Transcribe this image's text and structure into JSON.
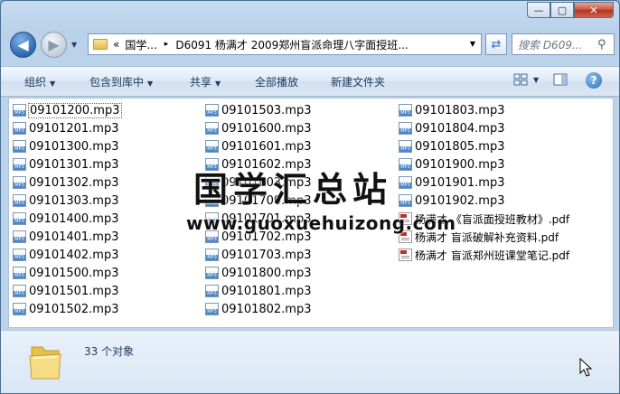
{
  "window": {
    "minimize": "—",
    "maximize": "▢",
    "close": "✕"
  },
  "address": {
    "history_glyph": "▼",
    "overflow": "«",
    "segments": [
      "国学...",
      "D6091 杨满才 2009郑州盲派命理八字面授班..."
    ],
    "separator": "▸",
    "dropdown": "▼"
  },
  "search": {
    "placeholder": "搜索 D609...",
    "icon": "magnifier-icon"
  },
  "toolbar": {
    "organize": "组织",
    "include_in_library": "包含到库中",
    "share": "共享",
    "play_all": "全部播放",
    "new_folder": "新建文件夹",
    "dropdown_arrow": "▼",
    "help": "?"
  },
  "files": {
    "col1": [
      {
        "name": "09101200.mp3",
        "type": "mp3",
        "selected": true
      },
      {
        "name": "09101201.mp3",
        "type": "mp3"
      },
      {
        "name": "09101300.mp3",
        "type": "mp3"
      },
      {
        "name": "09101301.mp3",
        "type": "mp3"
      },
      {
        "name": "09101302.mp3",
        "type": "mp3"
      },
      {
        "name": "09101303.mp3",
        "type": "mp3"
      },
      {
        "name": "09101400.mp3",
        "type": "mp3"
      },
      {
        "name": "09101401.mp3",
        "type": "mp3"
      },
      {
        "name": "09101402.mp3",
        "type": "mp3"
      },
      {
        "name": "09101500.mp3",
        "type": "mp3"
      },
      {
        "name": "09101501.mp3",
        "type": "mp3"
      },
      {
        "name": "09101502.mp3",
        "type": "mp3"
      }
    ],
    "col2": [
      {
        "name": "09101503.mp3",
        "type": "mp3"
      },
      {
        "name": "09101600.mp3",
        "type": "mp3"
      },
      {
        "name": "09101601.mp3",
        "type": "mp3"
      },
      {
        "name": "09101602.mp3",
        "type": "mp3"
      },
      {
        "name": "09101603.mp3",
        "type": "mp3"
      },
      {
        "name": "09101700.mp3",
        "type": "mp3"
      },
      {
        "name": "09101701.mp3",
        "type": "mp3"
      },
      {
        "name": "09101702.mp3",
        "type": "mp3"
      },
      {
        "name": "09101703.mp3",
        "type": "mp3"
      },
      {
        "name": "09101800.mp3",
        "type": "mp3"
      },
      {
        "name": "09101801.mp3",
        "type": "mp3"
      },
      {
        "name": "09101802.mp3",
        "type": "mp3"
      }
    ],
    "col3": [
      {
        "name": "09101803.mp3",
        "type": "mp3"
      },
      {
        "name": "09101804.mp3",
        "type": "mp3"
      },
      {
        "name": "09101805.mp3",
        "type": "mp3"
      },
      {
        "name": "09101900.mp3",
        "type": "mp3"
      },
      {
        "name": "09101901.mp3",
        "type": "mp3"
      },
      {
        "name": "09101902.mp3",
        "type": "mp3"
      },
      {
        "name": "杨满才 《盲派面授班教材》.pdf",
        "type": "pdf"
      },
      {
        "name": "杨满才 盲派破解补充资料.pdf",
        "type": "pdf"
      },
      {
        "name": "杨满才 盲派郑州班课堂笔记.pdf",
        "type": "pdf"
      }
    ]
  },
  "watermark": {
    "title": "国学汇总站",
    "url": "www.guoxuehuizong.com"
  },
  "status": {
    "count_text": "33 个对象"
  }
}
